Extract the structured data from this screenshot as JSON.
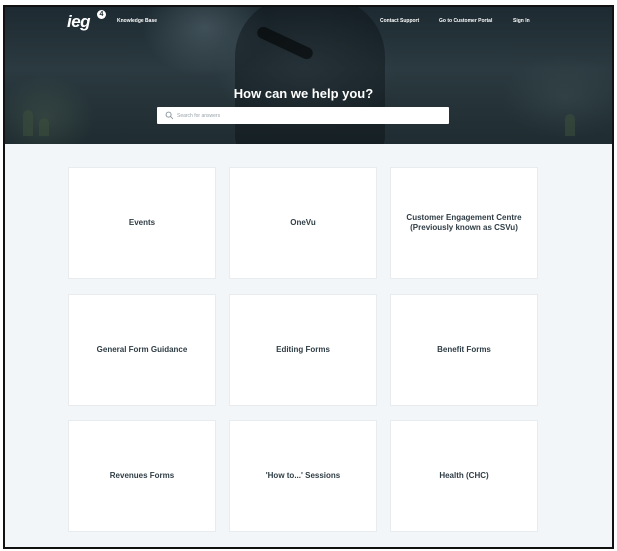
{
  "header": {
    "logo_text": "ieg",
    "logo_sup": "4",
    "section_label": "Knowledge Base",
    "nav": [
      {
        "label": "Contact Support"
      },
      {
        "label": "Go to Customer Portal"
      },
      {
        "label": "Sign In"
      }
    ]
  },
  "hero": {
    "title": "How can we help you?",
    "search_placeholder": "Search for answers",
    "search_icon": "search-icon"
  },
  "categories": [
    {
      "label": "Events"
    },
    {
      "label": "OneVu"
    },
    {
      "label": "Customer Engagement Centre\n(Previously known as CSVu)"
    },
    {
      "label": "General Form Guidance"
    },
    {
      "label": "Editing Forms"
    },
    {
      "label": "Benefit Forms"
    },
    {
      "label": "Revenues Forms"
    },
    {
      "label": "'How to...' Sessions"
    },
    {
      "label": "Health (CHC)"
    }
  ],
  "colors": {
    "hero_dark": "#1d2a31",
    "page_bg": "#f3f6f9",
    "card_bg": "#ffffff",
    "card_text": "#2f3d45"
  }
}
